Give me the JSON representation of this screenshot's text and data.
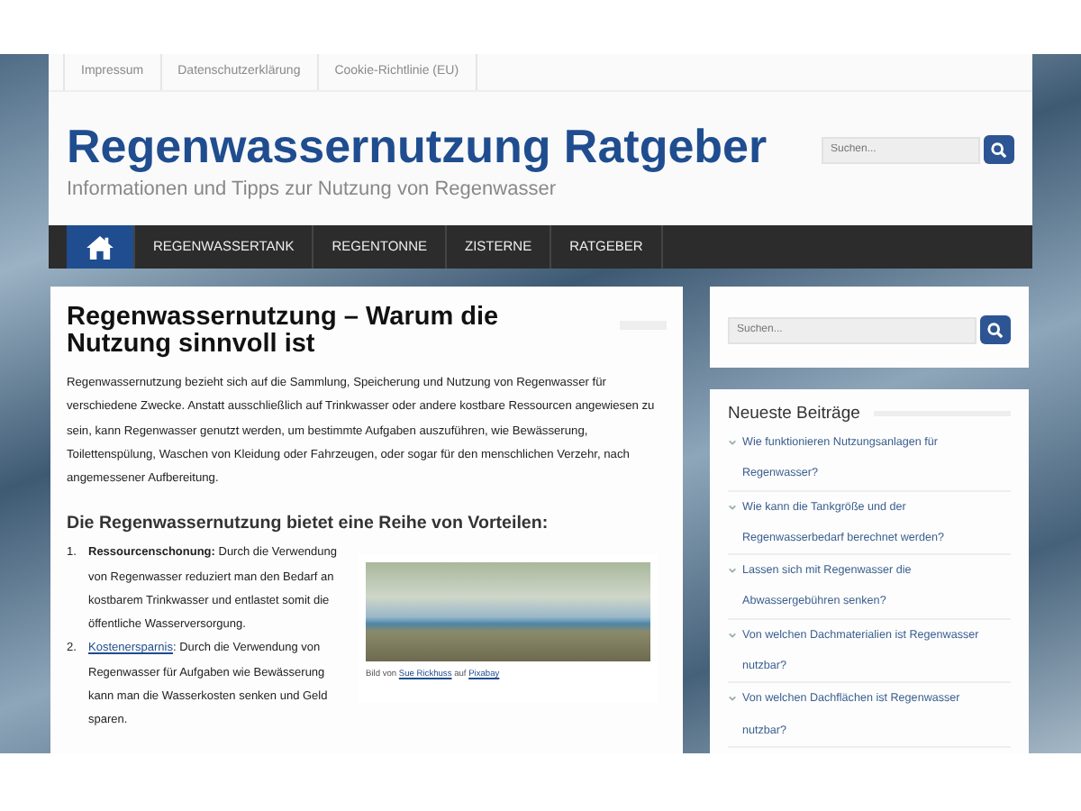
{
  "top_menu": [
    {
      "label": "Impressum"
    },
    {
      "label": "Datenschutzerklärung"
    },
    {
      "label": "Cookie-Richtlinie (EU)"
    }
  ],
  "site": {
    "title": "Regenwassernutzung Ratgeber",
    "tagline": "Informationen und Tipps zur Nutzung von Regenwasser"
  },
  "header_search": {
    "placeholder": "Suchen..."
  },
  "nav": [
    {
      "kind": "home",
      "selected": true
    },
    {
      "kind": "text",
      "label": "REGENWASSERTANK",
      "selected": false
    },
    {
      "kind": "text",
      "label": "REGENTONNE",
      "selected": false
    },
    {
      "kind": "text",
      "label": "ZISTERNE",
      "selected": false
    },
    {
      "kind": "text",
      "label": "RATGEBER",
      "selected": false
    }
  ],
  "article": {
    "title": "Regenwassernutzung – Warum die Nutzung sinnvoll ist",
    "intro": "Regenwassernutzung bezieht sich auf die Sammlung, Speicherung und Nutzung von Regenwasser für verschiedene Zwecke. Anstatt ausschließlich auf Trinkwasser oder andere kostbare Ressourcen angewiesen zu sein, kann Regenwasser genutzt werden, um bestimmte Aufgaben auszuführen, wie Bewässerung, Toilettenspülung, Waschen von Kleidung oder Fahrzeugen, oder sogar für den menschlichen Verzehr, nach angemessener Aufbereitung.",
    "subheading": "Die Regenwassernutzung bietet eine Reihe von Vorteilen:",
    "list": [
      {
        "number": "1.",
        "kind": "bold",
        "term": "Ressourcenschonung:",
        "text": "Durch die Verwendung von Regenwasser reduziert man den Bedarf an kostbarem Trinkwasser und entlastet somit die öffentliche Wasserversorgung."
      },
      {
        "number": "2.",
        "kind": "link",
        "term": "Kostenersparnis",
        "text": ": Durch die Verwendung von Regenwasser für Aufgaben wie Bewässerung kann man die Wasserkosten senken und Geld sparen."
      }
    ],
    "image_caption": {
      "prefix": "Bild von",
      "author": "Sue Rickhuss",
      "middle": "auf",
      "source": "Pixabay"
    }
  },
  "sidebar_search": {
    "placeholder": "Suchen..."
  },
  "recent_posts": {
    "title": "Neueste Beiträge",
    "items": [
      {
        "label": "Wie funktionieren Nutzungsanlagen für Regenwasser?"
      },
      {
        "label": "Wie kann die Tankgröße und der Regenwasserbedarf berechnet werden?"
      },
      {
        "label": "Lassen sich mit Regenwasser die Abwassergebühren senken?"
      },
      {
        "label": "Von welchen Dachmaterialien ist Regenwasser nutzbar?"
      },
      {
        "label": "Von welchen Dachflächen ist Regenwasser nutzbar?"
      }
    ]
  }
}
